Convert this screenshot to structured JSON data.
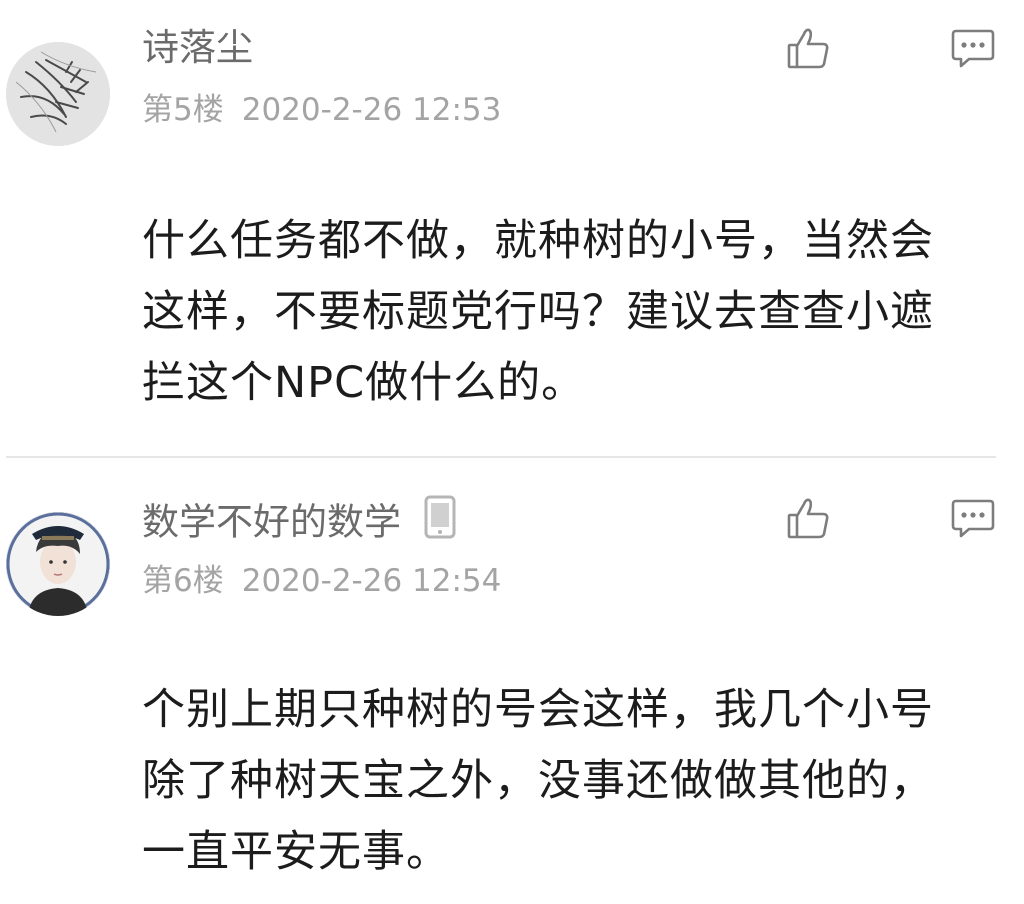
{
  "comments": [
    {
      "username": "诗落尘",
      "floor": "第5楼",
      "datetime": "2020-2-26 12:53",
      "content": "什么任务都不做，就种树的小号，当然会这样，不要标题党行吗？建议去查查小遮拦这个NPC做什么的。"
    },
    {
      "username": "数学不好的数学",
      "floor": "第6楼",
      "datetime": "2020-2-26 12:54",
      "content": "个别上期只种树的号会这样，我几个小号除了种树天宝之外，没事还做做其他的，一直平安无事。"
    }
  ],
  "icons": {
    "like": "thumbs-up-icon",
    "reply": "comment-bubble-icon",
    "device": "mobile-phone-icon"
  },
  "colors": {
    "username": "#6b6b6b",
    "meta": "#a4a4a4",
    "content": "#1c1c1c",
    "divider": "#e6e6e6",
    "icon_stroke": "#7d7d7d"
  }
}
